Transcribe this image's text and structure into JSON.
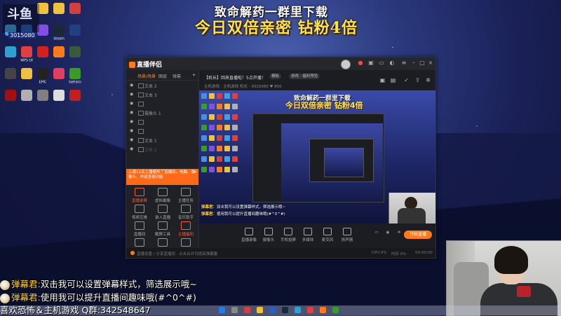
{
  "overlay": {
    "channel_logo": "斗鱼",
    "room_id": "3015080",
    "banner_line1": "致命解药一群里下载",
    "banner_line2": "今日双倍亲密 钻粉4倍"
  },
  "desktop_icons": [
    {
      "label": "",
      "color": "#4b8de0"
    },
    {
      "label": "",
      "color": "#f0c040"
    },
    {
      "label": "",
      "color": "#f0c040"
    },
    {
      "label": "",
      "color": "#f0c040"
    },
    {
      "label": "",
      "color": "#d04040"
    },
    {
      "label": "",
      "color": "#40a0e0"
    },
    {
      "label": "",
      "color": "#2a60c0"
    },
    {
      "label": "",
      "color": "#8050e0"
    },
    {
      "label": "Steam",
      "color": "#1b2838"
    },
    {
      "label": "",
      "color": "#204080"
    },
    {
      "label": "",
      "color": "#30a0d0"
    },
    {
      "label": "WPS Office",
      "color": "#e04040"
    },
    {
      "label": "",
      "color": "#d02020"
    },
    {
      "label": "",
      "color": "#ff7a1a"
    },
    {
      "label": "",
      "color": "#3a5a3a"
    },
    {
      "label": "",
      "color": "#444"
    },
    {
      "label": "",
      "color": "#f0c040"
    },
    {
      "label": "EPIC",
      "color": "#222"
    },
    {
      "label": "",
      "color": "#e04060"
    },
    {
      "label": "GeForce",
      "color": "#3a9a2a"
    },
    {
      "label": "",
      "color": "#a01010"
    },
    {
      "label": "",
      "color": "#b0b0b0"
    },
    {
      "label": "",
      "color": "#808080"
    },
    {
      "label": "",
      "color": "#ddd"
    },
    {
      "label": "",
      "color": "#c02020"
    }
  ],
  "app": {
    "name": "直播伴侣",
    "left_tabs": [
      "场景/场景",
      "图层",
      "弹幕"
    ],
    "scene_items": [
      {
        "name": "文本 2",
        "dim": false
      },
      {
        "name": "文本 3",
        "dim": false
      },
      {
        "name": "",
        "dim": true
      },
      {
        "name": "摄像头 1",
        "dim": false
      },
      {
        "name": "",
        "dim": true
      },
      {
        "name": "",
        "dim": true
      },
      {
        "name": "文本 1",
        "dim": false
      },
      {
        "name": "文本 2",
        "dim": true
      }
    ],
    "notice_text": "上周11名主播使用了直播间，电脑、摄像头，中途查看功能",
    "tools": [
      {
        "label": "直播录屏",
        "hot": true
      },
      {
        "label": "虚拟摄像",
        "hot": false
      },
      {
        "label": "主播任务",
        "hot": false
      },
      {
        "label": "视频互推",
        "hot": false
      },
      {
        "label": "录入直播",
        "hot": false
      },
      {
        "label": "音乐助手",
        "hot": false
      },
      {
        "label": "直播间",
        "hot": false
      },
      {
        "label": "截屏工具",
        "hot": false
      },
      {
        "label": "主播福利",
        "hot": true
      },
      {
        "label": "",
        "hot": false
      },
      {
        "label": "",
        "hot": false
      },
      {
        "label": "",
        "hot": false
      }
    ],
    "room_title": "【机长】回来直播啦！5点开播！",
    "pills": [
      "模板",
      "游戏 · 福利预览"
    ],
    "room_meta": "主机游戏 · 主机游戏  机长 · 3015080  ♥ 850",
    "preview_banner1": "致命解药一群里下载",
    "preview_banner2": "今日双倍亲密 钻粉4倍",
    "preview_chat": [
      {
        "who": "弹幕君：",
        "text": "双击我可以设置弹幕样式，筛选展示哦~"
      },
      {
        "who": "弹幕君：",
        "text": "使用我可以提升直播间趣味哦(#^0^#)"
      }
    ],
    "controls": [
      "直播录像",
      "摄像头",
      "手机投屏",
      "多媒体",
      "麦克风",
      "扬声器"
    ],
    "go_live": "开始直播",
    "status_left": "直播设置 / 分享直播间 · 点击合并可提高弹幕量",
    "status_right": [
      "CPU 0%",
      "内存 0%",
      "00:00:00"
    ]
  },
  "chat": [
    {
      "who": "弹幕君:",
      "text": "双击我可以设置弹幕样式，筛选展示哦~"
    },
    {
      "who": "弹幕君:",
      "text": "使用我可以提升直播间趣味哦(#^0^#)"
    }
  ],
  "footer_text": "喜欢恐怖＆主机游戏 Q群:342548647"
}
